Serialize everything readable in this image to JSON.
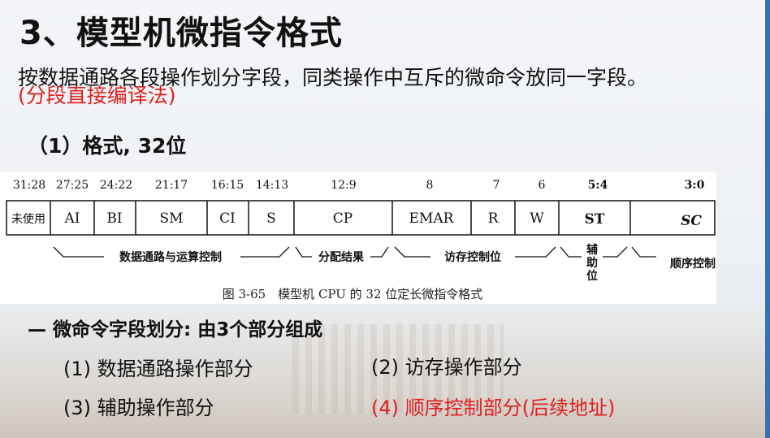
{
  "title": "3、模型机微指令格式",
  "intro": {
    "text": "按数据通路各段操作划分字段，同类操作中互斥的微命令放同一字段。",
    "method": "(分段直接编译法)"
  },
  "format_heading": "（1）格式, 32位",
  "figure": {
    "fields": [
      {
        "bits": "31:28",
        "name": "未使用"
      },
      {
        "bits": "27:25",
        "name": "AI"
      },
      {
        "bits": "24:22",
        "name": "BI"
      },
      {
        "bits": "21:17",
        "name": "SM"
      },
      {
        "bits": "16:15",
        "name": "CI"
      },
      {
        "bits": "14:13",
        "name": "S"
      },
      {
        "bits": "12:9",
        "name": "CP"
      },
      {
        "bits": "8",
        "name": "EMAR"
      },
      {
        "bits": "7",
        "name": "R"
      },
      {
        "bits": "6",
        "name": "W"
      },
      {
        "bits": "5:4",
        "name": "ST"
      },
      {
        "bits": "3:0",
        "name": "SC"
      }
    ],
    "groups": [
      {
        "label": "数据通路与运算控制"
      },
      {
        "label": "分配结果"
      },
      {
        "label": "访存控制位"
      },
      {
        "label_lines": [
          "辅",
          "助",
          "位"
        ]
      },
      {
        "label": "顺序控制"
      }
    ],
    "caption": "图 3-65　模型机 CPU 的 32 位定长微指令格式"
  },
  "division_heading": "— 微命令字段划分: 由3个部分组成",
  "parts": [
    "(1) 数据通路操作部分",
    "(2) 访存操作部分",
    "(3) 辅助操作部分",
    "(4) 顺序控制部分(后续地址)"
  ],
  "colors": {
    "highlight_red": "#e02020",
    "accent_blue": "#3a6fb0"
  }
}
